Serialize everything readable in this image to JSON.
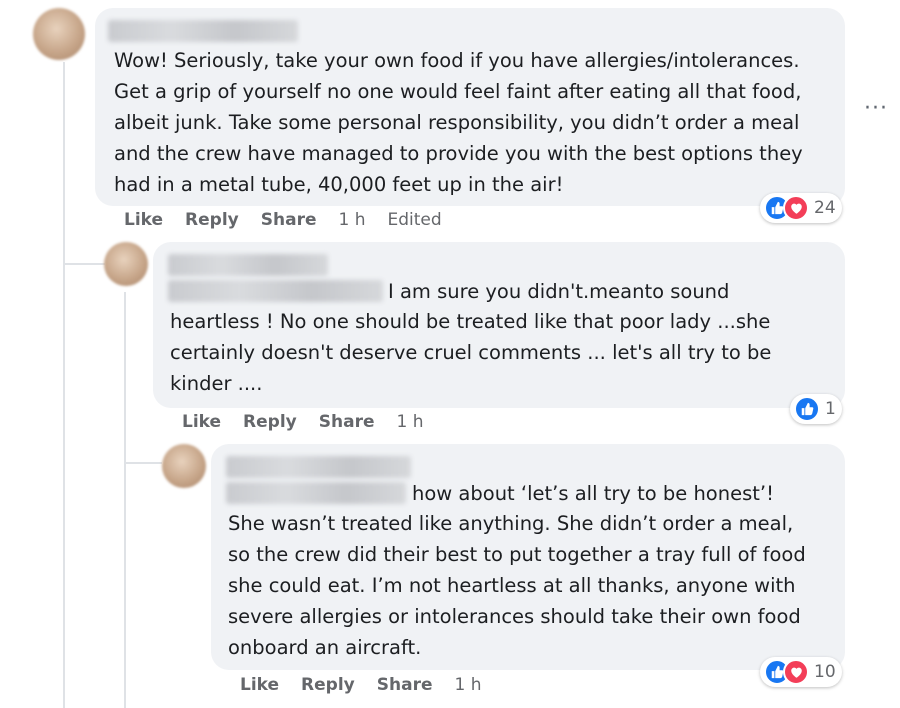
{
  "comments": [
    {
      "text": "Wow! Seriously, take your own food if you have allergies/intolerances.\nGet a grip of yourself no one would feel faint after eating all that food,\nalbeit junk. Take some personal responsibility, you didn’t order a meal\nand the crew have managed to provide you with the best options they\nhad in a metal tube, 40,000 feet up in the air!",
      "actions": {
        "like": "Like",
        "reply": "Reply",
        "share": "Share",
        "time": "1 h",
        "edited": "Edited"
      },
      "reactions": {
        "count": "24",
        "icons": [
          "like-icon",
          "love-icon"
        ]
      }
    },
    {
      "inline_text": "I am sure you didn't.meanto sound",
      "text": "heartless ! No one should be treated like that poor lady ...she\ncertainly doesn't deserve cruel comments ... let's all try to be\nkinder ....",
      "actions": {
        "like": "Like",
        "reply": "Reply",
        "share": "Share",
        "time": "1 h"
      },
      "reactions": {
        "count": "1",
        "icons": [
          "like-icon"
        ]
      }
    },
    {
      "inline_text": "how about ‘let’s all try to be honest’!",
      "text": "She wasn’t treated like anything. She didn’t order a meal,\nso the crew did their best to put together a tray full of food\nshe could eat. I’m not heartless at all thanks, anyone with\nsevere allergies or intolerances should take their own food\nonboard an aircraft.",
      "actions": {
        "like": "Like",
        "reply": "Reply",
        "share": "Share",
        "time": "1 h"
      },
      "reactions": {
        "count": "10",
        "icons": [
          "like-icon",
          "love-icon"
        ]
      }
    }
  ],
  "more_menu": "···",
  "colors": {
    "like": "#1877f2",
    "love": "#f33e58",
    "bubble": "#f0f2f5",
    "meta": "#65676b"
  }
}
